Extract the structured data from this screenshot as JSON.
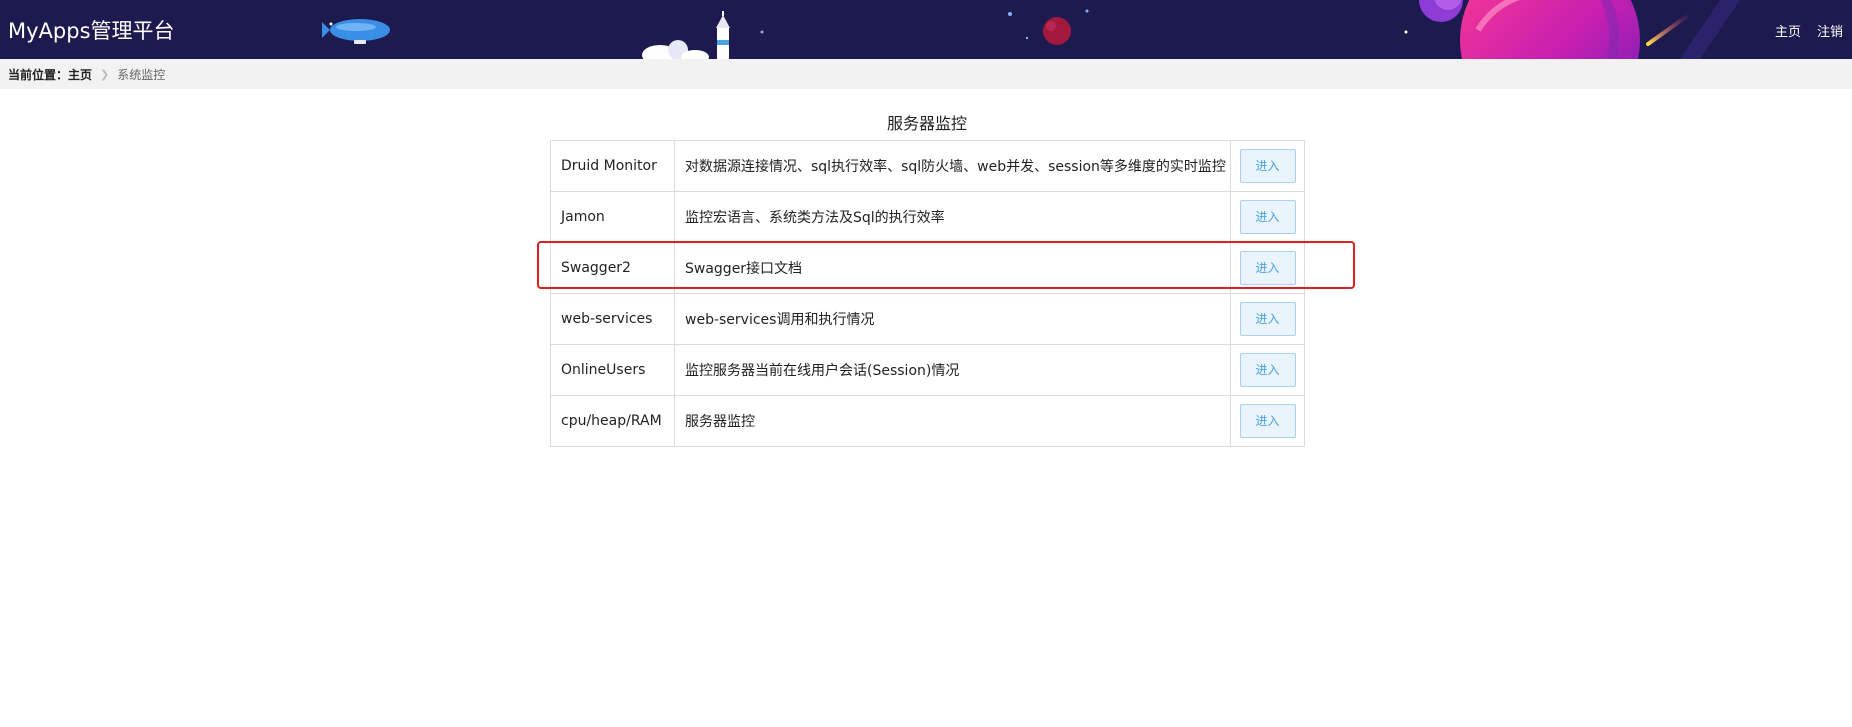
{
  "header": {
    "title": "MyApps管理平台",
    "nav": {
      "home": "主页",
      "logout": "注销"
    }
  },
  "breadcrumb": {
    "prefix": "当前位置：",
    "home": "主页",
    "current": "系统监控"
  },
  "main": {
    "title": "服务器监控",
    "rows": [
      {
        "name": "Druid Monitor",
        "description": "对数据源连接情况、sql执行效率、sql防火墙、web并发、session等多维度的实时监控",
        "action": "进入"
      },
      {
        "name": "Jamon",
        "description": "监控宏语言、系统类方法及Sql的执行效率",
        "action": "进入"
      },
      {
        "name": "Swagger2",
        "description": "Swagger接口文档",
        "action": "进入"
      },
      {
        "name": "web-services",
        "description": "web-services调用和执行情况",
        "action": "进入"
      },
      {
        "name": "OnlineUsers",
        "description": "监控服务器当前在线用户会话(Session)情况",
        "action": "进入"
      },
      {
        "name": "cpu/heap/RAM",
        "description": "服务器监控",
        "action": "进入"
      }
    ]
  },
  "colors": {
    "header_bg": "#1d1a4f",
    "highlight": "#e02020",
    "button_text": "#4ba2e0"
  }
}
